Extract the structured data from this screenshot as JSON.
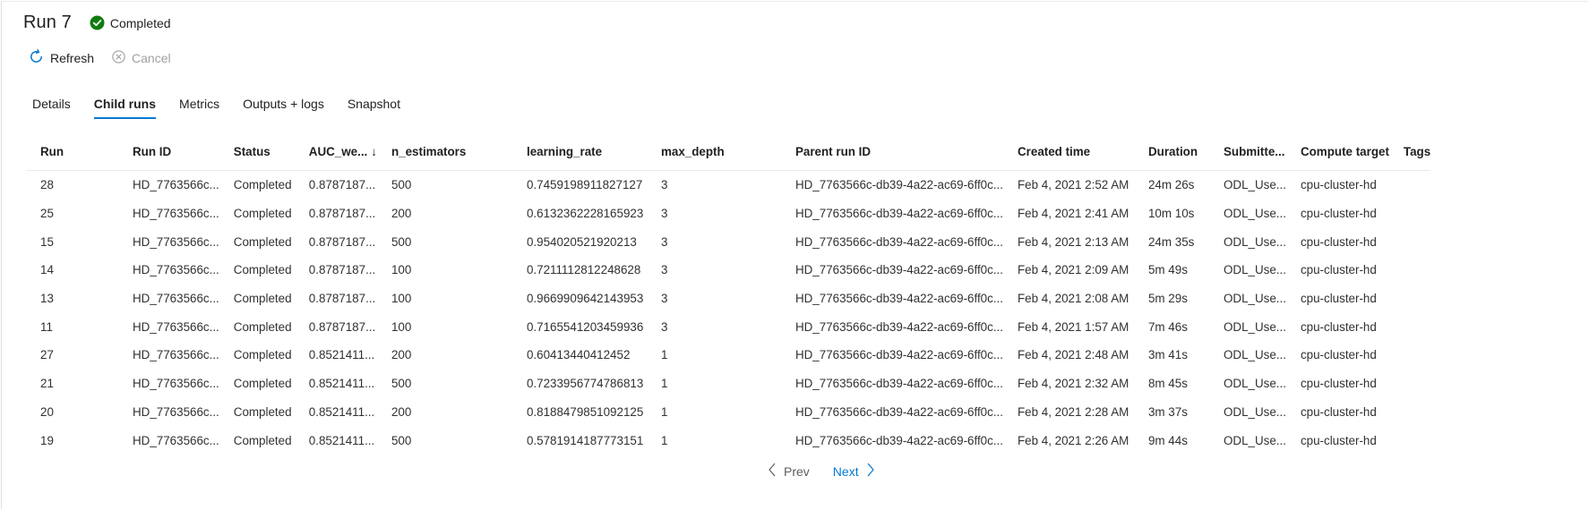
{
  "header": {
    "title": "Run 7",
    "status": "Completed"
  },
  "colors": {
    "accent": "#0078d4",
    "success": "#107c10",
    "text": "#201f1e",
    "disabled": "#a19f9d"
  },
  "toolbar": {
    "refresh_label": "Refresh",
    "cancel_label": "Cancel"
  },
  "tabs": [
    {
      "label": "Details",
      "active": false
    },
    {
      "label": "Child runs",
      "active": true
    },
    {
      "label": "Metrics",
      "active": false
    },
    {
      "label": "Outputs + logs",
      "active": false
    },
    {
      "label": "Snapshot",
      "active": false
    }
  ],
  "table": {
    "columns": [
      "Run",
      "Run ID",
      "Status",
      "AUC_we...",
      "n_estimators",
      "learning_rate",
      "max_depth",
      "Parent run ID",
      "Created time",
      "Duration",
      "Submitte...",
      "Compute target",
      "Tags"
    ],
    "sort_indicator": "↓",
    "rows": [
      [
        "28",
        "HD_7763566c...",
        "Completed",
        "0.8787187...",
        "500",
        "0.7459198911827127",
        "3",
        "HD_7763566c-db39-4a22-ac69-6ff0c...",
        "Feb 4, 2021 2:52 AM",
        "24m 26s",
        "ODL_Use...",
        "cpu-cluster-hd",
        ""
      ],
      [
        "25",
        "HD_7763566c...",
        "Completed",
        "0.8787187...",
        "200",
        "0.6132362228165923",
        "3",
        "HD_7763566c-db39-4a22-ac69-6ff0c...",
        "Feb 4, 2021 2:41 AM",
        "10m 10s",
        "ODL_Use...",
        "cpu-cluster-hd",
        ""
      ],
      [
        "15",
        "HD_7763566c...",
        "Completed",
        "0.8787187...",
        "500",
        "0.954020521920213",
        "3",
        "HD_7763566c-db39-4a22-ac69-6ff0c...",
        "Feb 4, 2021 2:13 AM",
        "24m 35s",
        "ODL_Use...",
        "cpu-cluster-hd",
        ""
      ],
      [
        "14",
        "HD_7763566c...",
        "Completed",
        "0.8787187...",
        "100",
        "0.7211112812248628",
        "3",
        "HD_7763566c-db39-4a22-ac69-6ff0c...",
        "Feb 4, 2021 2:09 AM",
        "5m 49s",
        "ODL_Use...",
        "cpu-cluster-hd",
        ""
      ],
      [
        "13",
        "HD_7763566c...",
        "Completed",
        "0.8787187...",
        "100",
        "0.9669909642143953",
        "3",
        "HD_7763566c-db39-4a22-ac69-6ff0c...",
        "Feb 4, 2021 2:08 AM",
        "5m 29s",
        "ODL_Use...",
        "cpu-cluster-hd",
        ""
      ],
      [
        "11",
        "HD_7763566c...",
        "Completed",
        "0.8787187...",
        "100",
        "0.7165541203459936",
        "3",
        "HD_7763566c-db39-4a22-ac69-6ff0c...",
        "Feb 4, 2021 1:57 AM",
        "7m 46s",
        "ODL_Use...",
        "cpu-cluster-hd",
        ""
      ],
      [
        "27",
        "HD_7763566c...",
        "Completed",
        "0.8521411...",
        "200",
        "0.60413440412452",
        "1",
        "HD_7763566c-db39-4a22-ac69-6ff0c...",
        "Feb 4, 2021 2:48 AM",
        "3m 41s",
        "ODL_Use...",
        "cpu-cluster-hd",
        ""
      ],
      [
        "21",
        "HD_7763566c...",
        "Completed",
        "0.8521411...",
        "500",
        "0.7233956774786813",
        "1",
        "HD_7763566c-db39-4a22-ac69-6ff0c...",
        "Feb 4, 2021 2:32 AM",
        "8m 45s",
        "ODL_Use...",
        "cpu-cluster-hd",
        ""
      ],
      [
        "20",
        "HD_7763566c...",
        "Completed",
        "0.8521411...",
        "200",
        "0.8188479851092125",
        "1",
        "HD_7763566c-db39-4a22-ac69-6ff0c...",
        "Feb 4, 2021 2:28 AM",
        "3m 37s",
        "ODL_Use...",
        "cpu-cluster-hd",
        ""
      ],
      [
        "19",
        "HD_7763566c...",
        "Completed",
        "0.8521411...",
        "500",
        "0.5781914187773151",
        "1",
        "HD_7763566c-db39-4a22-ac69-6ff0c...",
        "Feb 4, 2021 2:26 AM",
        "9m 44s",
        "ODL_Use...",
        "cpu-cluster-hd",
        ""
      ]
    ]
  },
  "pager": {
    "prev_label": "Prev",
    "next_label": "Next"
  }
}
